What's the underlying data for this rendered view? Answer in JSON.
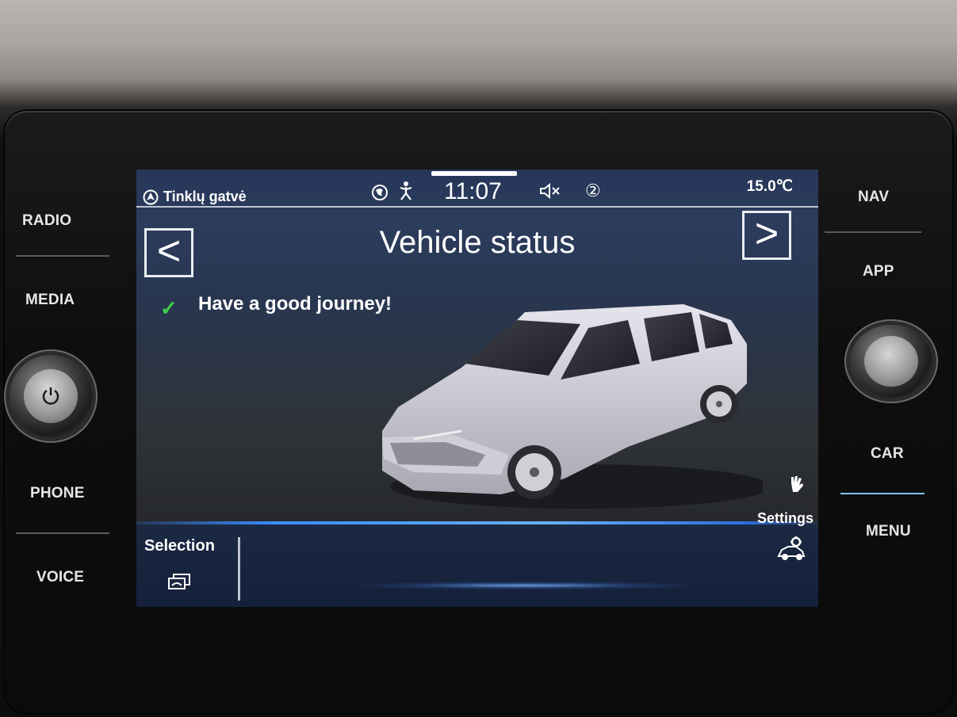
{
  "hardware": {
    "left_buttons": [
      "RADIO",
      "MEDIA",
      "PHONE",
      "VOICE"
    ],
    "right_buttons": [
      "NAV",
      "APP",
      "CAR",
      "MENU"
    ]
  },
  "status_bar": {
    "location": "Tinklų gatvė",
    "time": "11:07",
    "badge": "②",
    "temperature": "15.0℃"
  },
  "header": {
    "title": "Vehicle status",
    "prev_label": "<",
    "next_label": ">"
  },
  "status_message": "Have a good journey!",
  "bottom_bar": {
    "selection_label": "Selection",
    "settings_label": "Settings"
  },
  "colors": {
    "screen_bg": "#283650",
    "accent_blue": "#3a8cff",
    "check_green": "#3fd14a"
  },
  "icons": [
    "nav-arrow-icon",
    "globe-icon",
    "pedestrian-icon",
    "sound-off-icon",
    "check-icon",
    "car-image",
    "hand-icon",
    "selection-icon",
    "settings-car-icon",
    "power-icon"
  ]
}
